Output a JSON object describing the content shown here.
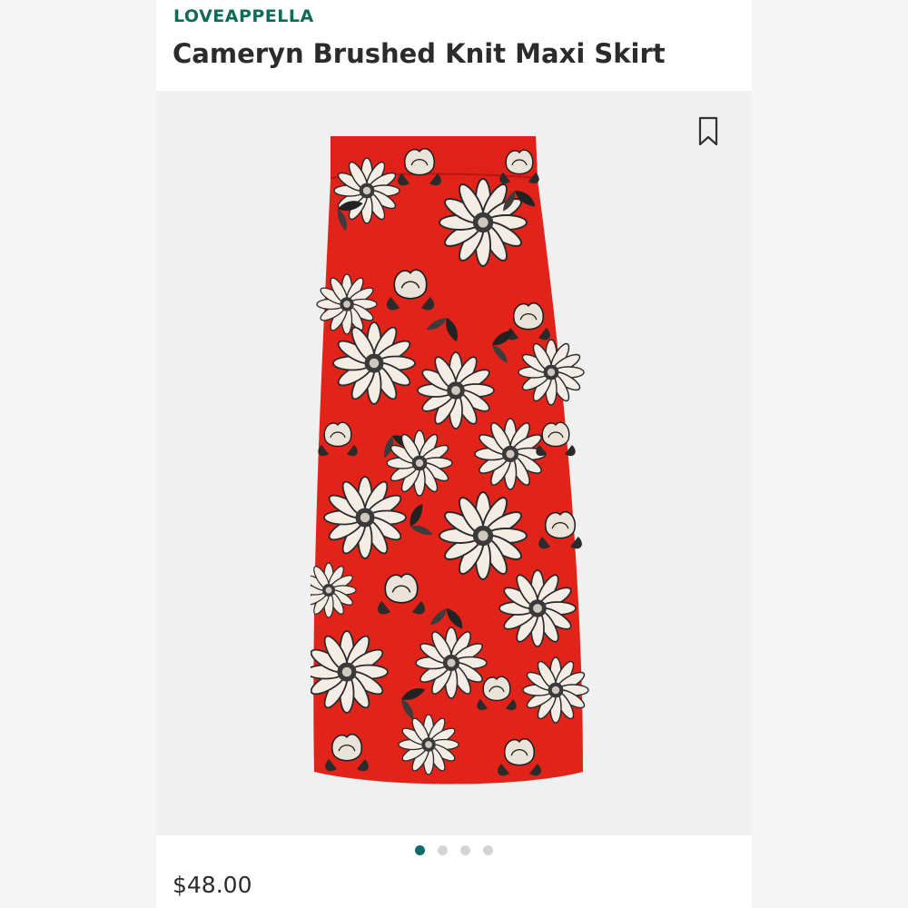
{
  "product": {
    "brand": "LOVEAPPELLA",
    "title": "Cameryn Brushed Knit Maxi Skirt",
    "price": "$48.00"
  },
  "carousel": {
    "total_slides": 4,
    "active_index": 0
  },
  "icons": {
    "bookmark": "bookmark-icon"
  },
  "colors": {
    "brand": "#0e6b58",
    "skirt_red": "#e2231a",
    "dot_active": "#0e6b6b",
    "dot_inactive": "#d4d4d4"
  }
}
